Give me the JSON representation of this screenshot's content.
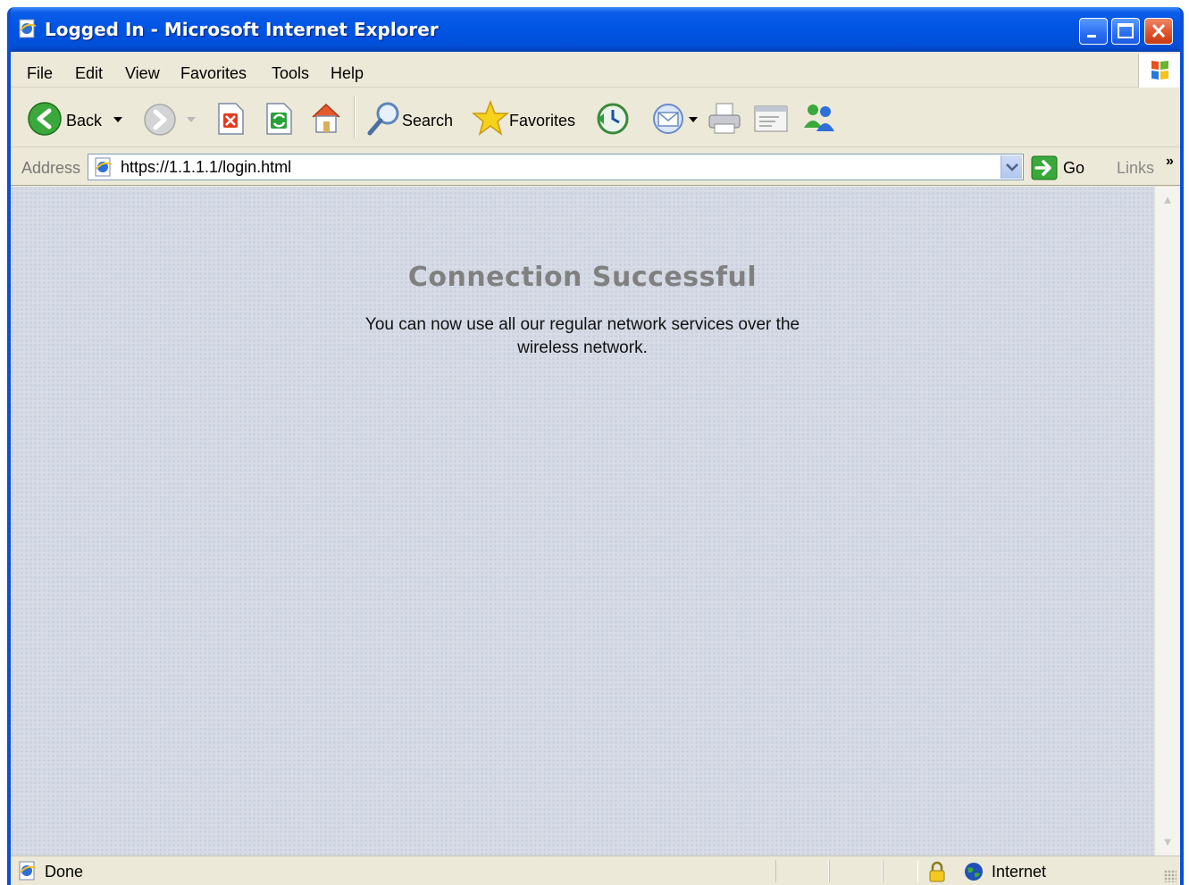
{
  "window": {
    "title": "Logged In - Microsoft Internet Explorer"
  },
  "menu": [
    {
      "label": "File"
    },
    {
      "label": "Edit"
    },
    {
      "label": "View"
    },
    {
      "label": "Favorites"
    },
    {
      "label": "Tools"
    },
    {
      "label": "Help"
    }
  ],
  "toolbar": {
    "back_label": "Back",
    "search_label": "Search",
    "favorites_label": "Favorites"
  },
  "address": {
    "label": "Address",
    "value": "https://1.1.1.1/login.html",
    "go_label": "Go",
    "links_label": "Links",
    "links_chevron": "»"
  },
  "page": {
    "heading": "Connection Successful",
    "message": "You can now use all our regular network services over the wireless network."
  },
  "status": {
    "text": "Done",
    "zone": "Internet"
  },
  "colors": {
    "titlebar": "#0054e3",
    "chrome": "#ece9d8",
    "content_bg": "#d6dbe6",
    "heading": "#808080"
  }
}
